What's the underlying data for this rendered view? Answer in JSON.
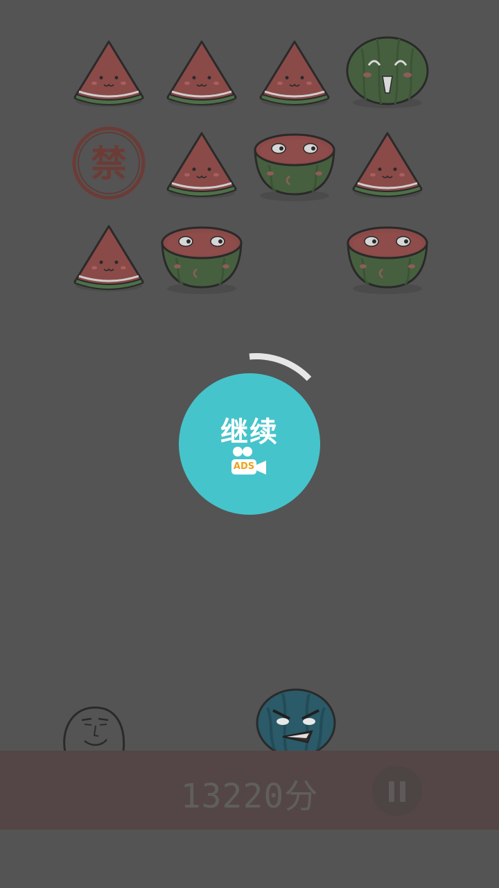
{
  "board": {
    "rows": [
      [
        "slice",
        "slice",
        "slice",
        "whole-happy"
      ],
      [
        "forbidden",
        "slice",
        "half",
        "slice"
      ],
      [
        "slice",
        "half",
        "empty",
        "half"
      ]
    ],
    "forbidden_glyph": "禁"
  },
  "overlay": {
    "continue_label": "继续",
    "ads_label": "ADS",
    "button_color": "#46c4cb",
    "icon": "video-camera-icon"
  },
  "footer": {
    "score_text": "13220分",
    "pause_icon": "pause-icon"
  },
  "colors": {
    "background": "#545454",
    "bar": "#544646",
    "accent": "#46c4cb",
    "ads": "#f0a21c"
  }
}
